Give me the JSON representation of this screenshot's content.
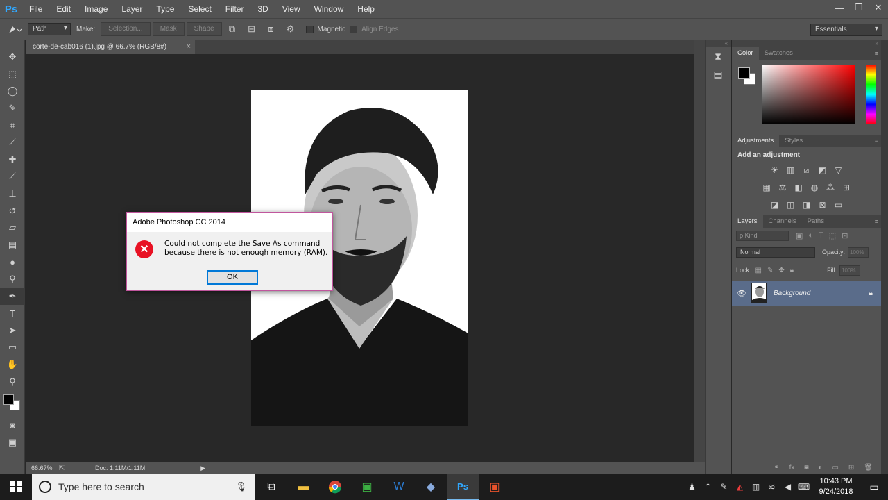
{
  "app": {
    "logo": "Ps"
  },
  "menu": [
    "File",
    "Edit",
    "Image",
    "Layer",
    "Type",
    "Select",
    "Filter",
    "3D",
    "View",
    "Window",
    "Help"
  ],
  "window_controls": {
    "minimize": "—",
    "restore": "❐",
    "close": "✕"
  },
  "options_bar": {
    "mode_value": "Path",
    "make_label": "Make:",
    "selection_btn": "Selection...",
    "mask_btn": "Mask",
    "shape_btn": "Shape",
    "magnetic_label": "Magnetic",
    "align_edges_label": "Align Edges",
    "workspace": "Essentials"
  },
  "document": {
    "tab_title": "corte-de-cab016 (1).jpg @ 66.7% (RGB/8#)",
    "tab_close": "×"
  },
  "status": {
    "zoom": "66.67%",
    "doc_size": "Doc: 1.11M/1.11M",
    "arrow": "▶"
  },
  "panels": {
    "color_tabs": [
      "Color",
      "Swatches"
    ],
    "adjustments_tabs": [
      "Adjustments",
      "Styles"
    ],
    "adjustments_title": "Add an adjustment",
    "layers_tabs": [
      "Layers",
      "Channels",
      "Paths"
    ],
    "kind": "ρ Kind",
    "blend_mode": "Normal",
    "opacity_label": "Opacity:",
    "opacity_value": "100%",
    "lock_label": "Lock:",
    "fill_label": "Fill:",
    "fill_value": "100%",
    "layer_name": "Background"
  },
  "dialog": {
    "title": "Adobe Photoshop CC 2014",
    "message": "Could not complete the Save As command because there is not enough memory (RAM).",
    "ok": "OK",
    "error_glyph": "✕"
  },
  "taskbar": {
    "search_placeholder": "Type here to search",
    "time": "10:43 PM",
    "date": "9/24/2018"
  },
  "colors": {
    "accent_blue": "#31a8ff",
    "error_red": "#e81123",
    "layer_selected": "#5a6c8a"
  }
}
